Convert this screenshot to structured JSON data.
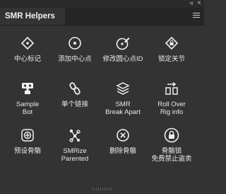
{
  "window": {
    "collapse_glyph": "«",
    "close_glyph": "×"
  },
  "panel": {
    "title": "SMR Helpers"
  },
  "tools": [
    {
      "icon": "diamond-target-icon",
      "label": "中心标记",
      "label2": ""
    },
    {
      "icon": "circle-dot-icon",
      "label": "添加中心点",
      "label2": ""
    },
    {
      "icon": "circle-pencil-icon",
      "label": "修改圆心点ID",
      "label2": ""
    },
    {
      "icon": "lock-chain-icon",
      "label": "锁定关节",
      "label2": ""
    },
    {
      "icon": "robot-icon",
      "label": "Sample",
      "label2": "Bot"
    },
    {
      "icon": "link-icon",
      "label": "单个链接",
      "label2": ""
    },
    {
      "icon": "layers-icon",
      "label": "SMR",
      "label2": "Break Apart"
    },
    {
      "icon": "rig-rollover-icon",
      "label": "Roll Over",
      "label2": "Rig info"
    },
    {
      "icon": "bone-target-icon",
      "label": "预设骨骼",
      "label2": ""
    },
    {
      "icon": "rig-nodes-icon",
      "label": "SMRize",
      "label2": "Parented"
    },
    {
      "icon": "circle-x-icon",
      "label": "删除骨骼",
      "label2": ""
    },
    {
      "icon": "padlock-icon",
      "label": "骨骼锁",
      "label2": "免费禁止盗卖"
    }
  ]
}
